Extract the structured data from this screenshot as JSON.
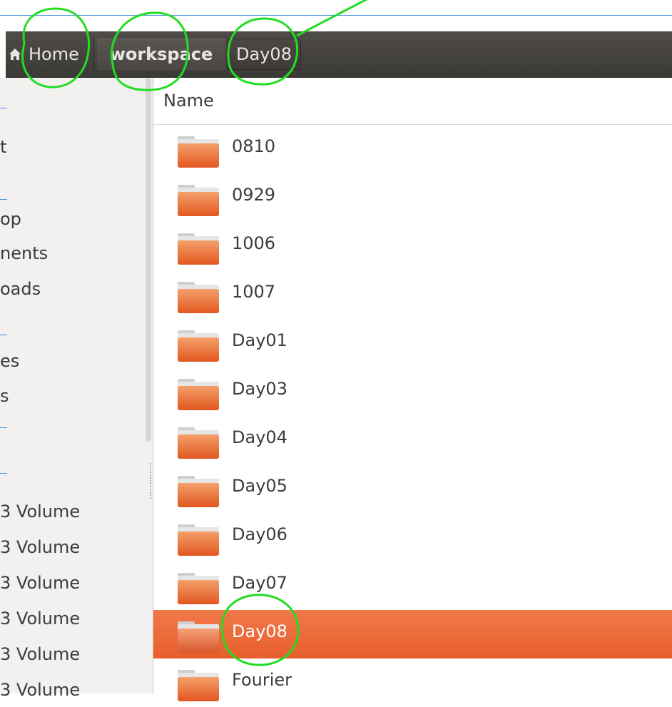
{
  "breadcrumb": {
    "home_label": "Home",
    "workspace_label": "workspace",
    "current_label": "Day08"
  },
  "sidebar": {
    "items": [
      {
        "label": "t"
      },
      {
        "label": "op"
      },
      {
        "label": "nents"
      },
      {
        "label": "oads"
      },
      {
        "label": "es"
      },
      {
        "label": "s"
      },
      {
        "label": "3 Volume"
      },
      {
        "label": "3 Volume"
      },
      {
        "label": "3 Volume"
      },
      {
        "label": "3 Volume"
      },
      {
        "label": "3 Volume"
      },
      {
        "label": "3 Volume"
      }
    ]
  },
  "list": {
    "column_name": "Name",
    "files": [
      {
        "name": "0810",
        "selected": false
      },
      {
        "name": "0929",
        "selected": false
      },
      {
        "name": "1006",
        "selected": false
      },
      {
        "name": "1007",
        "selected": false
      },
      {
        "name": "Day01",
        "selected": false
      },
      {
        "name": "Day03",
        "selected": false
      },
      {
        "name": "Day04",
        "selected": false
      },
      {
        "name": "Day05",
        "selected": false
      },
      {
        "name": "Day06",
        "selected": false
      },
      {
        "name": "Day07",
        "selected": false
      },
      {
        "name": "Day08",
        "selected": true
      },
      {
        "name": "Fourier",
        "selected": false
      }
    ]
  },
  "colors": {
    "selection": "#e96a3a",
    "toolbar": "#45423f",
    "annotation": "#22dd22"
  },
  "icons": {
    "folder": "folder-icon",
    "home": "home-icon"
  }
}
